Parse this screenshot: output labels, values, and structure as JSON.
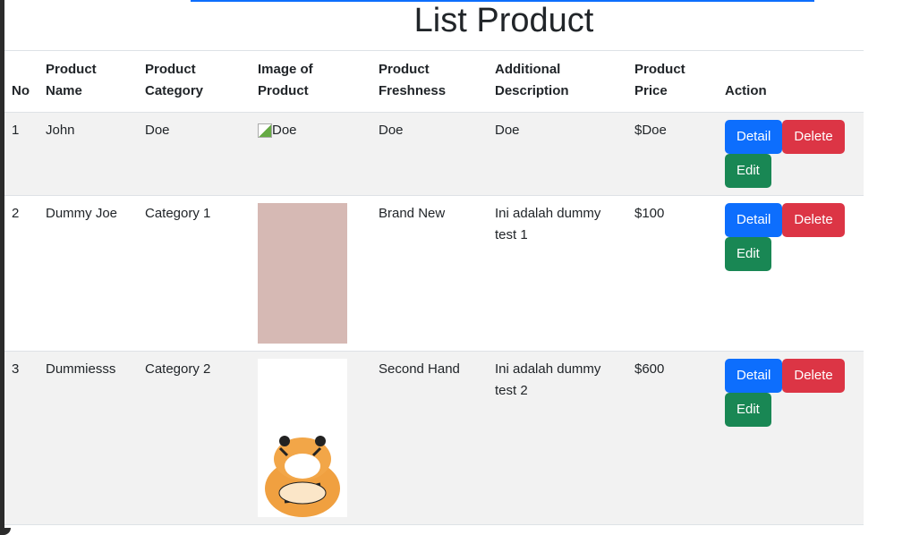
{
  "title": "List Product",
  "headers": [
    "No",
    "Product Name",
    "Product Category",
    "Image of Product",
    "Product Freshness",
    "Additional Description",
    "Product Price",
    "Action"
  ],
  "rows": [
    {
      "no": "1",
      "name": "John",
      "category": "Doe",
      "image_alt": "Doe",
      "freshness": "Doe",
      "description": "Doe",
      "price": "$Doe"
    },
    {
      "no": "2",
      "name": "Dummy Joe",
      "category": "Category 1",
      "image_alt": "",
      "freshness": "Brand New",
      "description": "Ini adalah dummy test 1",
      "price": "$100"
    },
    {
      "no": "3",
      "name": "Dummiesss",
      "category": "Category 2",
      "image_alt": "",
      "freshness": "Second Hand",
      "description": "Ini adalah dummy test 2",
      "price": "$600"
    }
  ],
  "actions": {
    "detail": "Detail",
    "delete": "Delete",
    "edit": "Edit"
  },
  "colors": {
    "detail": "#0d6efd",
    "delete": "#dc3545",
    "edit": "#198754",
    "row_alt": "#f2f2f2"
  }
}
